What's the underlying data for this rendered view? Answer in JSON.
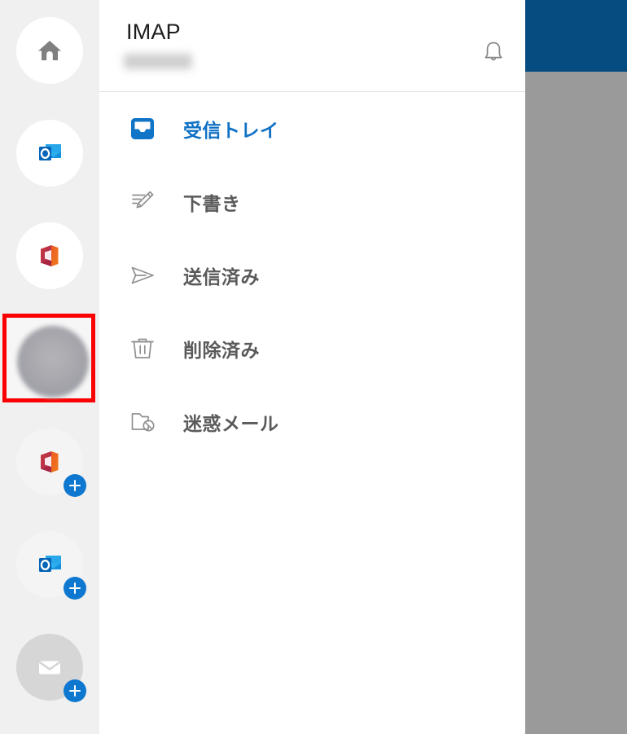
{
  "window": {
    "background_panel_color": "#9a9a9a",
    "background_header_color": "#074c80"
  },
  "rail": {
    "background_color": "#f0f0f0",
    "accounts": [
      {
        "id": "home",
        "icon": "home-icon",
        "label": "ホーム",
        "badge": false,
        "style": "white"
      },
      {
        "id": "outlook",
        "icon": "outlook-icon",
        "label": "Outlook",
        "badge": false,
        "style": "white"
      },
      {
        "id": "office",
        "icon": "office-icon",
        "label": "Office",
        "badge": false,
        "style": "white"
      },
      {
        "id": "user-account",
        "icon": "user-avatar-icon",
        "label": "アカウント",
        "badge": false,
        "style": "selected"
      },
      {
        "id": "add-office",
        "icon": "office-icon",
        "label": "Office を追加",
        "badge": true,
        "style": "faint"
      },
      {
        "id": "add-outlook",
        "icon": "outlook-icon",
        "label": "Outlook を追加",
        "badge": true,
        "style": "faint"
      },
      {
        "id": "add-mail",
        "icon": "mail-icon",
        "label": "メールを追加",
        "badge": true,
        "style": "gray"
      }
    ],
    "selection": {
      "highlighted_account_id": "user-account",
      "highlight_color": "#fb0000",
      "highlight_border_px": 5
    },
    "badge": {
      "symbol": "+",
      "color": "#0e78d0"
    }
  },
  "header": {
    "title": "IMAP",
    "subtitle": "",
    "subtitle_redacted": true,
    "notification_icon": "bell-icon"
  },
  "folders": {
    "items": [
      {
        "icon": "inbox-icon",
        "label": "受信トレイ",
        "active": true,
        "color": "#1071c4"
      },
      {
        "icon": "drafts-icon",
        "label": "下書き",
        "active": false,
        "color": "#5a5a5a"
      },
      {
        "icon": "sent-icon",
        "label": "送信済み",
        "active": false,
        "color": "#5a5a5a"
      },
      {
        "icon": "deleted-icon",
        "label": "削除済み",
        "active": false,
        "color": "#5a5a5a"
      },
      {
        "icon": "junk-icon",
        "label": "迷惑メール",
        "active": false,
        "color": "#5a5a5a"
      }
    ]
  }
}
